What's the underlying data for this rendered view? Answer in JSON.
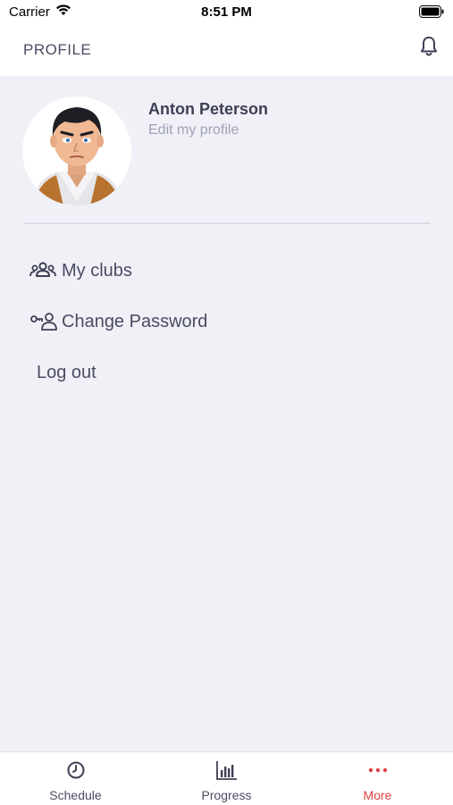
{
  "status_bar": {
    "carrier": "Carrier",
    "time": "8:51 PM"
  },
  "header": {
    "title": "PROFILE",
    "bell_icon": "bell-icon"
  },
  "profile": {
    "name": "Anton Peterson",
    "edit_link": "Edit my profile"
  },
  "menu": [
    {
      "label": "My clubs",
      "icon": "users-icon"
    },
    {
      "label": "Change Password",
      "icon": "key-user-icon"
    },
    {
      "label": "Log out"
    }
  ],
  "tabs": [
    {
      "label": "Schedule",
      "icon": "clock-icon",
      "active": false
    },
    {
      "label": "Progress",
      "icon": "bar-chart-icon",
      "active": false
    },
    {
      "label": "More",
      "icon": "more-dots-icon",
      "active": true
    }
  ],
  "colors": {
    "background": "#f0f0f7",
    "text": "#3f3f55",
    "muted": "#a0a0b8",
    "accent": "#e04040"
  }
}
